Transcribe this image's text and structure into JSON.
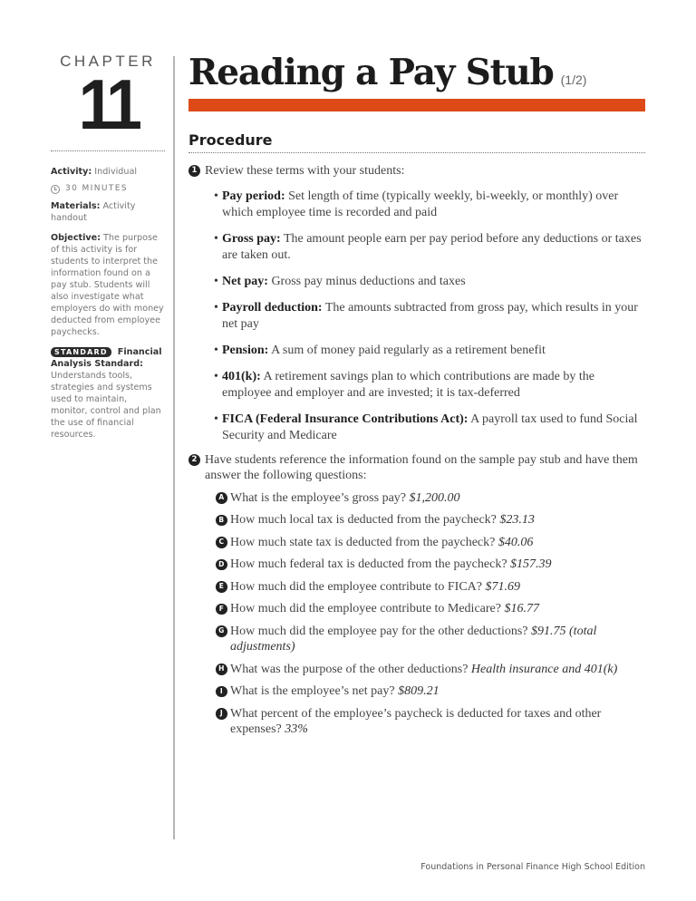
{
  "sidebar": {
    "chapter_label": "CHAPTER",
    "chapter_number": "11",
    "activity_label": "Activity:",
    "activity_value": "Individual",
    "clock_icon": "clock-icon",
    "duration": "30 MINUTES",
    "materials_label": "Materials:",
    "materials_value": "Activity handout",
    "objective_label": "Objective:",
    "objective_text": "The purpose of this activity is for students to interpret the information found on a pay stub. Students will also investigate what employers do with money deducted from employee paychecks.",
    "standard_badge": "STANDARD",
    "standard_label": "Financial Analysis Standard:",
    "standard_text": "Understands tools, strategies and systems used to maintain, monitor, control and plan the use of financial resources."
  },
  "header": {
    "title": "Reading a Pay Stub",
    "part": "(1/2)",
    "accent_color": "#dd4a18"
  },
  "procedure": {
    "heading": "Procedure",
    "steps": [
      {
        "number": "1",
        "text": "Review these terms with your students:",
        "terms": [
          {
            "term": "Pay period:",
            "definition": "Set length of time (typically weekly, bi-weekly, or monthly) over which employee time is recorded and paid"
          },
          {
            "term": "Gross pay:",
            "definition": "The amount people earn per pay period before any deductions or taxes are taken out."
          },
          {
            "term": "Net pay:",
            "definition": "Gross pay minus deductions and taxes"
          },
          {
            "term": "Payroll deduction:",
            "definition": "The amounts subtracted from gross pay, which results in your net pay"
          },
          {
            "term": "Pension:",
            "definition": "A sum of money paid regularly as a retirement benefit"
          },
          {
            "term": "401(k):",
            "definition": "A retirement savings plan to which contributions are made by the employee and employer and are invested; it is tax-deferred"
          },
          {
            "term": "FICA (Federal Insurance Contributions Act):",
            "definition": "A payroll tax used to fund Social Security and Medicare"
          }
        ]
      },
      {
        "number": "2",
        "text": "Have students reference the information found on the sample pay stub and have them answer the following questions:",
        "questions": [
          {
            "letter": "A",
            "question": "What is the employee’s gross pay?",
            "answer": "$1,200.00"
          },
          {
            "letter": "B",
            "question": "How much local tax is deducted from the paycheck?",
            "answer": "$23.13"
          },
          {
            "letter": "C",
            "question": "How much state tax is deducted from the paycheck?",
            "answer": "$40.06"
          },
          {
            "letter": "D",
            "question": "How much federal tax is deducted from the paycheck?",
            "answer": "$157.39"
          },
          {
            "letter": "E",
            "question": "How much did the employee contribute to FICA?",
            "answer": "$71.69"
          },
          {
            "letter": "F",
            "question": "How much did the employee contribute to Medicare?",
            "answer": "$16.77"
          },
          {
            "letter": "G",
            "question": "How much did the employee pay for the other deductions?",
            "answer": "$91.75 (total adjustments)"
          },
          {
            "letter": "H",
            "question": "What was the purpose of the other deductions?",
            "answer": "Health insurance and 401(k)"
          },
          {
            "letter": "I",
            "question": "What is the employee’s net pay?",
            "answer": "$809.21"
          },
          {
            "letter": "J",
            "question": "What percent of the employee’s paycheck is deducted for taxes and other expenses?",
            "answer": "33%"
          }
        ]
      }
    ]
  },
  "footer": {
    "text": "Foundations in Personal Finance High School Edition"
  }
}
